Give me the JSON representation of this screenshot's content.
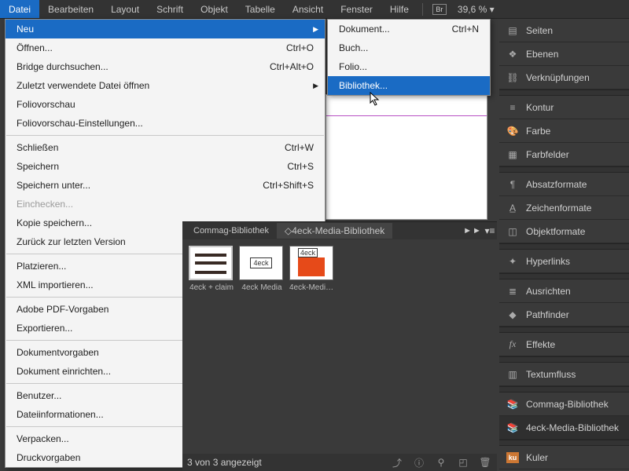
{
  "menubar": {
    "items": [
      "Datei",
      "Bearbeiten",
      "Layout",
      "Schrift",
      "Objekt",
      "Tabelle",
      "Ansicht",
      "Fenster",
      "Hilfe"
    ],
    "bridge_badge": "Br",
    "zoom": "39,6 %"
  },
  "panels": [
    {
      "icon": "pages",
      "label": "Seiten"
    },
    {
      "icon": "layers",
      "label": "Ebenen"
    },
    {
      "icon": "links",
      "label": "Verknüpfungen"
    },
    {
      "gap": true
    },
    {
      "icon": "stroke",
      "label": "Kontur"
    },
    {
      "icon": "color",
      "label": "Farbe"
    },
    {
      "icon": "swatches",
      "label": "Farbfelder"
    },
    {
      "gap": true
    },
    {
      "icon": "para",
      "label": "Absatzformate"
    },
    {
      "icon": "char",
      "label": "Zeichenformate"
    },
    {
      "icon": "obj",
      "label": "Objektformate"
    },
    {
      "gap": true
    },
    {
      "icon": "hyper",
      "label": "Hyperlinks"
    },
    {
      "gap": true
    },
    {
      "icon": "align",
      "label": "Ausrichten"
    },
    {
      "icon": "path",
      "label": "Pathfinder"
    },
    {
      "gap": true
    },
    {
      "icon": "fx",
      "label": "Effekte"
    },
    {
      "gap": true
    },
    {
      "icon": "wrap",
      "label": "Textumfluss"
    },
    {
      "gap": true
    },
    {
      "icon": "lib",
      "label": "Commag-Bibliothek"
    },
    {
      "icon": "lib",
      "label": "4eck-Media-Bibliothek",
      "active": true
    },
    {
      "gap": true
    },
    {
      "icon": "ku",
      "label": "Kuler"
    }
  ],
  "file_menu": [
    {
      "label": "Neu",
      "arrow": true,
      "highlight": true
    },
    {
      "label": "Öffnen...",
      "shortcut": "Ctrl+O"
    },
    {
      "label": "Bridge durchsuchen...",
      "shortcut": "Ctrl+Alt+O"
    },
    {
      "label": "Zuletzt verwendete Datei öffnen",
      "arrow": true
    },
    {
      "label": "Foliovorschau"
    },
    {
      "label": "Foliovorschau-Einstellungen..."
    },
    {
      "sep": true
    },
    {
      "label": "Schließen",
      "shortcut": "Ctrl+W"
    },
    {
      "label": "Speichern",
      "shortcut": "Ctrl+S"
    },
    {
      "label": "Speichern unter...",
      "shortcut": "Ctrl+Shift+S"
    },
    {
      "label": "Einchecken...",
      "disabled": true
    },
    {
      "label": "Kopie speichern..."
    },
    {
      "label": "Zurück zur letzten Version"
    },
    {
      "sep": true
    },
    {
      "label": "Platzieren..."
    },
    {
      "label": "XML importieren..."
    },
    {
      "sep": true
    },
    {
      "label": "Adobe PDF-Vorgaben"
    },
    {
      "label": "Exportieren..."
    },
    {
      "sep": true
    },
    {
      "label": "Dokumentvorgaben"
    },
    {
      "label": "Dokument einrichten..."
    },
    {
      "sep": true
    },
    {
      "label": "Benutzer..."
    },
    {
      "label": "Dateiinformationen..."
    },
    {
      "sep": true
    },
    {
      "label": "Verpacken..."
    },
    {
      "label": "Druckvorgaben"
    }
  ],
  "new_submenu": [
    {
      "label": "Dokument...",
      "shortcut": "Ctrl+N"
    },
    {
      "label": "Buch..."
    },
    {
      "label": "Folio..."
    },
    {
      "label": "Bibliothek...",
      "highlight": true
    }
  ],
  "library": {
    "tabs": [
      "Commag-Bibliothek",
      "4eck-Media-Bibliothek"
    ],
    "active_tab": 1,
    "sort_glyph": "◇",
    "expand": "►►",
    "menu": "▾≡",
    "thumbs": [
      {
        "caption": "4eck + claim"
      },
      {
        "caption": "4eck Media",
        "text": "4eck"
      },
      {
        "caption": "4eck-Media...",
        "text": "4eck"
      }
    ],
    "status": "3 von 3 angezeigt"
  },
  "cursor_arrow": "▸"
}
